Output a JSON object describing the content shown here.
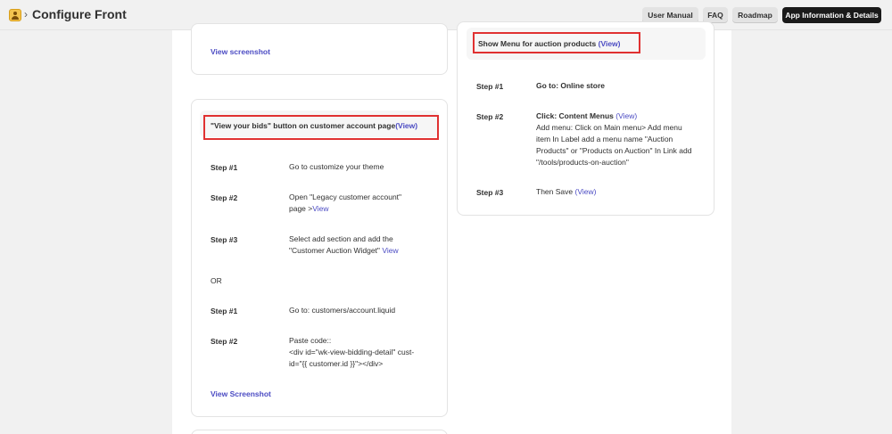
{
  "header": {
    "title": "Configure Front",
    "breadcrumb_sep": "›",
    "buttons": [
      "User Manual",
      "FAQ",
      "Roadmap",
      "App Information & Details"
    ]
  },
  "left_top_card": {
    "link": "View screenshot"
  },
  "left_card": {
    "heading": "\"View your bids\" button on customer account page",
    "heading_link": "(View)",
    "steps": [
      {
        "label": "Step #1",
        "text": "Go to customize your theme"
      },
      {
        "label": "Step #2",
        "text": "Open \"Legacy customer account\" page >",
        "link": "View"
      },
      {
        "label": "Step #3",
        "text": "Select add section and add the \"Customer Auction Widget\" ",
        "link": "View"
      }
    ],
    "or": "OR",
    "steps_alt": [
      {
        "label": "Step #1",
        "text": "Go to: customers/account.liquid"
      },
      {
        "label": "Step #2",
        "text_line1": "Paste code::",
        "text_code": "<div id=\"wk-view-bidding-detail\" cust-id=\"{{ customer.id }}\"></div>"
      }
    ],
    "footer_link": "View Screenshot"
  },
  "right_card": {
    "heading": "Show Menu for auction products",
    "heading_link": "(View)",
    "steps": [
      {
        "label": "Step #1",
        "text": "Go to: Online store"
      },
      {
        "label": "Step #2",
        "title": "Click: Content Menus",
        "link": "(View)",
        "text": "Add menu: Click on Main menu> Add menu item In Label add a menu name \"Auction Products\" or \"Products on Auction\" In Link add \"/tools/products-on-auction\""
      },
      {
        "label": "Step #3",
        "text": "Then Save",
        "link": "(View)"
      }
    ]
  },
  "colors": {
    "accent": "#4b4bc3",
    "highlight": "#e03131",
    "dark_button": "#1a1a1a"
  }
}
